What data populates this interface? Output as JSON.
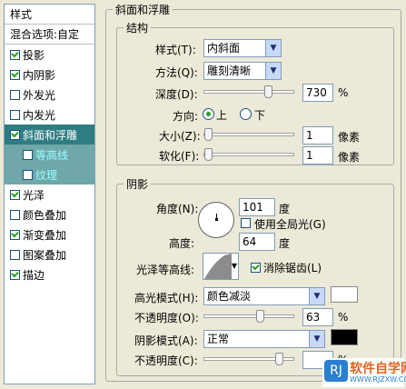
{
  "left_panel": {
    "styles_label": "样式",
    "blend_options_label": "混合选项:自定",
    "items": [
      {
        "label": "投影",
        "checked": true
      },
      {
        "label": "内阴影",
        "checked": true
      },
      {
        "label": "外发光",
        "checked": false
      },
      {
        "label": "内发光",
        "checked": false
      },
      {
        "label": "斜面和浮雕",
        "checked": true,
        "selected": true
      },
      {
        "label": "等高线",
        "checked": false,
        "sub": true
      },
      {
        "label": "纹理",
        "checked": false,
        "sub": true
      },
      {
        "label": "光泽",
        "checked": true
      },
      {
        "label": "颜色叠加",
        "checked": false
      },
      {
        "label": "渐变叠加",
        "checked": true
      },
      {
        "label": "图案叠加",
        "checked": false
      },
      {
        "label": "描边",
        "checked": true
      }
    ]
  },
  "bevel": {
    "title": "斜面和浮雕",
    "structure": {
      "title": "结构",
      "style_label": "样式(T):",
      "style_value": "内斜面",
      "technique_label": "方法(Q):",
      "technique_value": "雕刻清晰",
      "depth_label": "深度(D):",
      "depth_value": "730",
      "depth_unit": "%",
      "depth_fraction": 0.73,
      "direction_label": "方向:",
      "direction_up": "上",
      "direction_down": "下",
      "size_label": "大小(Z):",
      "size_value": "1",
      "size_unit": "像素",
      "soften_label": "软化(F):",
      "soften_value": "1",
      "soften_unit": "像素"
    },
    "shading": {
      "title": "阴影",
      "angle_label": "角度(N):",
      "angle_value": "101",
      "angle_unit": "度",
      "global_light_label": "使用全局光(G)",
      "altitude_label": "高度:",
      "altitude_value": "64",
      "altitude_unit": "度",
      "gloss_contour_label": "光泽等高线:",
      "anti_alias_label": "消除锯齿(L)",
      "highlight_mode_label": "高光模式(H):",
      "highlight_mode_value": "颜色减淡",
      "highlight_color": "#ffffff",
      "highlight_opacity_label": "不透明度(O):",
      "highlight_opacity_value": "63",
      "highlight_opacity_unit": "%",
      "highlight_opacity_fraction": 0.63,
      "shadow_mode_label": "阴影模式(A):",
      "shadow_mode_value": "正常",
      "shadow_color": "#000000",
      "shadow_opacity_label": "不透明度(C):",
      "shadow_opacity_unit": "%"
    }
  },
  "watermark": {
    "brand": "软件自学网",
    "url": "WWW.RJZXW.COM"
  }
}
